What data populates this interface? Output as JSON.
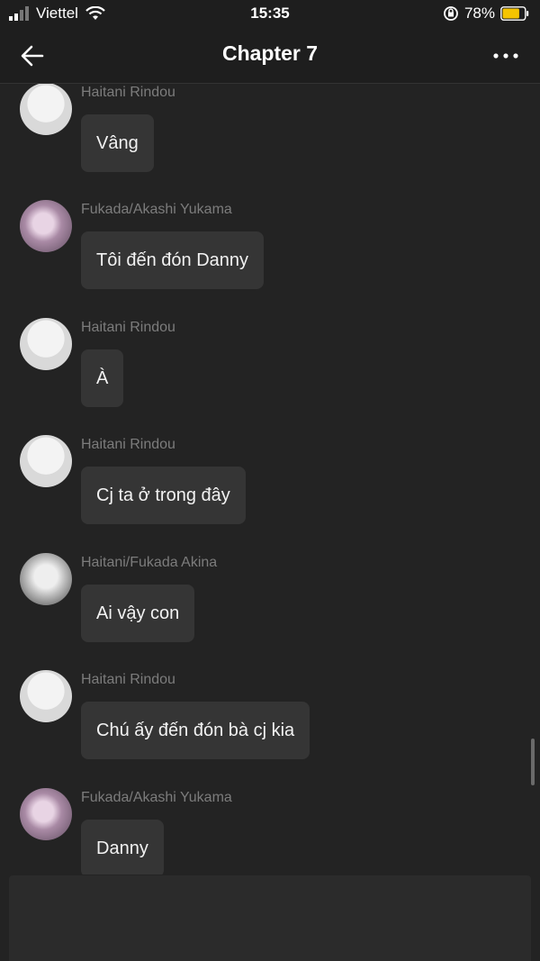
{
  "status_bar": {
    "carrier": "Viettel",
    "time": "15:35",
    "battery_percent": "78%",
    "battery_level": 0.78,
    "battery_color": "#f5c400"
  },
  "header": {
    "title": "Chapter 7"
  },
  "messages": [
    {
      "sender": "Haitani Rindou",
      "text": "Vâng",
      "avatar": "sketch"
    },
    {
      "sender": "Fukada/Akashi Yukama",
      "text": "Tôi đến đón Danny",
      "avatar": "blur"
    },
    {
      "sender": "Haitani Rindou",
      "text": "À",
      "avatar": "sketch"
    },
    {
      "sender": "Haitani Rindou",
      "text": "Cj ta ở trong đây",
      "avatar": "sketch"
    },
    {
      "sender": "Haitani/Fukada Akina",
      "text": "Ai vậy con",
      "avatar": "anime"
    },
    {
      "sender": "Haitani Rindou",
      "text": "Chú ấy đến đón bà cj kia",
      "avatar": "sketch"
    },
    {
      "sender": "Fukada/Akashi Yukama",
      "text": "Danny",
      "avatar": "blur"
    }
  ]
}
